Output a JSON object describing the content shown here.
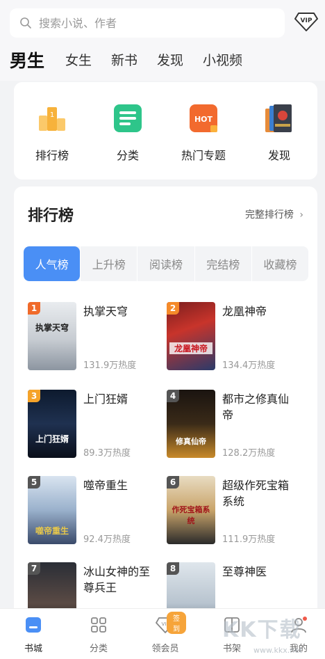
{
  "search": {
    "placeholder": "搜索小说、作者"
  },
  "header": {
    "vip_label": "VIP"
  },
  "tabs": [
    "男生",
    "女生",
    "新书",
    "发现",
    "小视频"
  ],
  "quick_nav": [
    {
      "label": "排行榜",
      "icon": "trophy-podium-icon"
    },
    {
      "label": "分类",
      "icon": "category-grid-icon"
    },
    {
      "label": "热门专题",
      "icon": "hot-topic-icon"
    },
    {
      "label": "发现",
      "icon": "book-stack-icon"
    }
  ],
  "ranking": {
    "title": "排行榜",
    "more": "完整排行榜",
    "segments": [
      "人气榜",
      "上升榜",
      "阅读榜",
      "完结榜",
      "收藏榜"
    ],
    "books": [
      {
        "rank": "1",
        "title": "执掌天穹",
        "heat": "131.9万热度",
        "cover_text": "执掌天穹"
      },
      {
        "rank": "2",
        "title": "龙凰神帝",
        "heat": "134.4万热度",
        "cover_text": "龙凰神帝"
      },
      {
        "rank": "3",
        "title": "上门狂婿",
        "heat": "89.3万热度",
        "cover_text": "上门狂婿"
      },
      {
        "rank": "4",
        "title": "都市之修真仙帝",
        "heat": "128.2万热度",
        "cover_text": "修真仙帝"
      },
      {
        "rank": "5",
        "title": "噬帝重生",
        "heat": "92.4万热度",
        "cover_text": "噬帝重生"
      },
      {
        "rank": "6",
        "title": "超级作死宝箱系统",
        "heat": "111.9万热度",
        "cover_text": "作死宝箱系统"
      },
      {
        "rank": "7",
        "title": "冰山女神的至尊兵王",
        "heat": "",
        "cover_text": ""
      },
      {
        "rank": "8",
        "title": "至尊神医",
        "heat": "",
        "cover_text": ""
      }
    ]
  },
  "bottom_nav": [
    {
      "label": "书城",
      "icon": "bookstore-icon"
    },
    {
      "label": "分类",
      "icon": "category-icon"
    },
    {
      "label": "领会员",
      "icon": "vip-diamond-icon",
      "badge": "签到"
    },
    {
      "label": "书架",
      "icon": "bookshelf-icon"
    },
    {
      "label": "我的",
      "icon": "profile-icon"
    }
  ],
  "watermark": {
    "main": "KK下载",
    "sub": "www.kkx.net"
  },
  "colors": {
    "accent": "#4a8ff5",
    "badge1": "#f06a2a",
    "badge2": "#f58a2a",
    "badge3": "#f5a32a",
    "badge_other": "#555555"
  }
}
